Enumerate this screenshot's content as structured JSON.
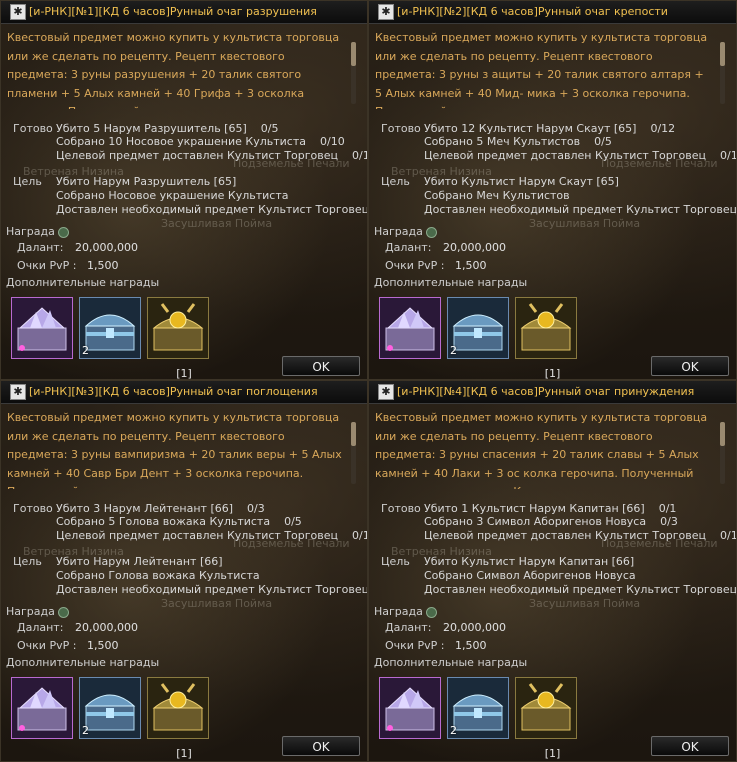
{
  "labels": {
    "ready": "Готово",
    "goal": "Цель",
    "reward": "Награда",
    "adena": "Далант:",
    "pvp": "Очки PvP :",
    "extra_rewards": "Дополнительные награды",
    "ok": "OK"
  },
  "map_labels": {
    "windy_plain": "Ветреная Низина",
    "underground": "Подземелье Печали",
    "dry_floodplain": "Засушливая Пойма",
    "desert": "Плато Печали"
  },
  "panels": [
    {
      "title": "[и-РНК][№1][КД 6 часов]Рунный очаг разрушения",
      "desc": "Квестовый предмет можно купить у культиста торговца или же сделать по рецепту. Рецепт квестового предмета: 3 руны разрушения + 20 талик святого пламени + 5 Алых камней + 40 Грифа + 3 осколка герочипа. Полученный предмет нужно",
      "ready": [
        {
          "text": "Убито 5 Нарум Разрушитель [65]",
          "count": "0/5"
        },
        {
          "text": "Собрано 10 Носовое украшение Культиста",
          "count": "0/10"
        },
        {
          "text": "Целевой предмет доставлен Культист Торговец",
          "count": "0/1"
        }
      ],
      "goal": [
        "Убито Нарум Разрушитель [65]",
        "Собрано Носовое украшение Культиста",
        "Доставлен необходимый предмет Культист Торговец"
      ],
      "adena": "20,000,000",
      "pvp": "1,500",
      "slot2_count": "2",
      "page": "[1]"
    },
    {
      "title": "[и-РНК][№2][КД 6 часов]Рунный очаг крепости",
      "desc": "Квестовый предмет можно купить у культиста торговца или же сделать по рецепту. Рецепт квестового предмета: 3 руны з ащиты + 20 талик святого алтаря + 5 Алых камней + 40 Мид- мика + 3 осколка герочипа. Полученный предмет нужно отд",
      "ready": [
        {
          "text": "Убито 12 Культист Нарум Скаут [65]",
          "count": "0/12"
        },
        {
          "text": "Собрано 5 Меч Культистов",
          "count": "0/5"
        },
        {
          "text": "Целевой предмет доставлен Культист Торговец",
          "count": "0/1"
        }
      ],
      "goal": [
        "Убито Культист Нарум Скаут [65]",
        "Собрано Меч Культистов",
        "Доставлен необходимый предмет Культист Торговец"
      ],
      "adena": "20,000,000",
      "pvp": "1,500",
      "slot2_count": "2",
      "page": "[1]"
    },
    {
      "title": "[и-РНК][№3][КД 6 часов]Рунный очаг поглощения",
      "desc": "Квестовый предмет можно купить у культиста торговца или же сделать по рецепту. Рецепт квестового предмета: 3 руны вампиризма + 20 талик веры + 5 Алых камней + 40 Савр Бри Дент + 3 осколка герочипа. Полученный предмет нужно отд",
      "ready": [
        {
          "text": "Убито 3 Нарум Лейтенант [66]",
          "count": "0/3"
        },
        {
          "text": "Собрано 5 Голова вожака Культиста",
          "count": "0/5"
        },
        {
          "text": "Целевой предмет доставлен Культист Торговец",
          "count": "0/1"
        }
      ],
      "goal": [
        "Убито Нарум Лейтенант [66]",
        "Собрано Голова вожака Культиста",
        "Доставлен необходимый предмет Культист Торговец"
      ],
      "adena": "20,000,000",
      "pvp": "1,500",
      "slot2_count": "2",
      "page": "[1]"
    },
    {
      "title": "[и-РНК][№4][КД 6 часов]Рунный очаг принуждения",
      "desc": "Квестовый предмет можно купить у культиста торговца или же сделать по рецепту. Рецепт квестового предмета: 3 руны спасения + 20 талик славы + 5 Алых камней + 40 Лаки + 3 ос колка герочипа. Полученный предмет нужно отдать Культис",
      "ready": [
        {
          "text": "Убито 1 Культист Нарум Капитан [66]",
          "count": "0/1"
        },
        {
          "text": "Собрано 3 Символ Аборигенов Новуса",
          "count": "0/3"
        },
        {
          "text": "Целевой предмет доставлен Культист Торговец",
          "count": "0/1"
        }
      ],
      "goal": [
        "Убито Культист Нарум Капитан [66]",
        "Собрано Символ Аборигенов Новуса",
        "Доставлен необходимый предмет Культист Торговец"
      ],
      "adena": "20,000,000",
      "pvp": "1,500",
      "slot2_count": "2",
      "page": "[1]"
    }
  ]
}
